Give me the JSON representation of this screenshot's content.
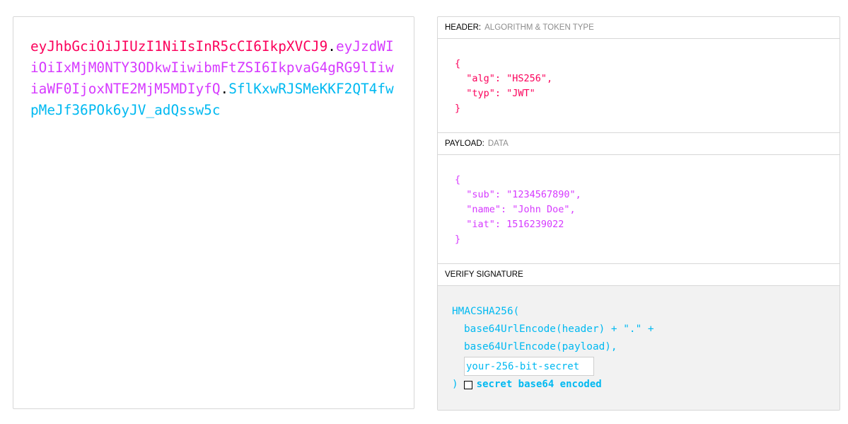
{
  "encoded": {
    "header": "eyJhbGciOiJIUzI1NiIsInR5cCI6IkpXVCJ9",
    "payload": "eyJzdWIiOiIxMjM0NTY3ODkwIiwibmFtZSI6IkpvaG4gRG9lIiwiaWF0IjoxNTE2MjM5MDIyfQ",
    "signature": "SflKxwRJSMeKKF2QT4fwpMeJf36POk6yJV_adQssw5c",
    "dot": "."
  },
  "header_section": {
    "title": "HEADER:",
    "subtitle": "ALGORITHM & TOKEN TYPE",
    "lines": [
      "{",
      "  \"alg\": \"HS256\",",
      "  \"typ\": \"JWT\"",
      "}"
    ]
  },
  "payload_section": {
    "title": "PAYLOAD:",
    "subtitle": "DATA",
    "lines": [
      "{",
      "  \"sub\": \"1234567890\",",
      "  \"name\": \"John Doe\",",
      "  \"iat\": 1516239022",
      "}"
    ]
  },
  "verify_section": {
    "title": "VERIFY SIGNATURE",
    "line1": "HMACSHA256(",
    "line2": "base64UrlEncode(header) + \".\" +",
    "line3": "base64UrlEncode(payload),",
    "secret_placeholder": "your-256-bit-secret",
    "secret_value": "",
    "close_paren": ")",
    "checkbox_label": "secret base64 encoded",
    "checkbox_checked": false
  },
  "colors": {
    "header": "#fb015b",
    "payload": "#d63aff",
    "signature": "#00b9f1"
  }
}
